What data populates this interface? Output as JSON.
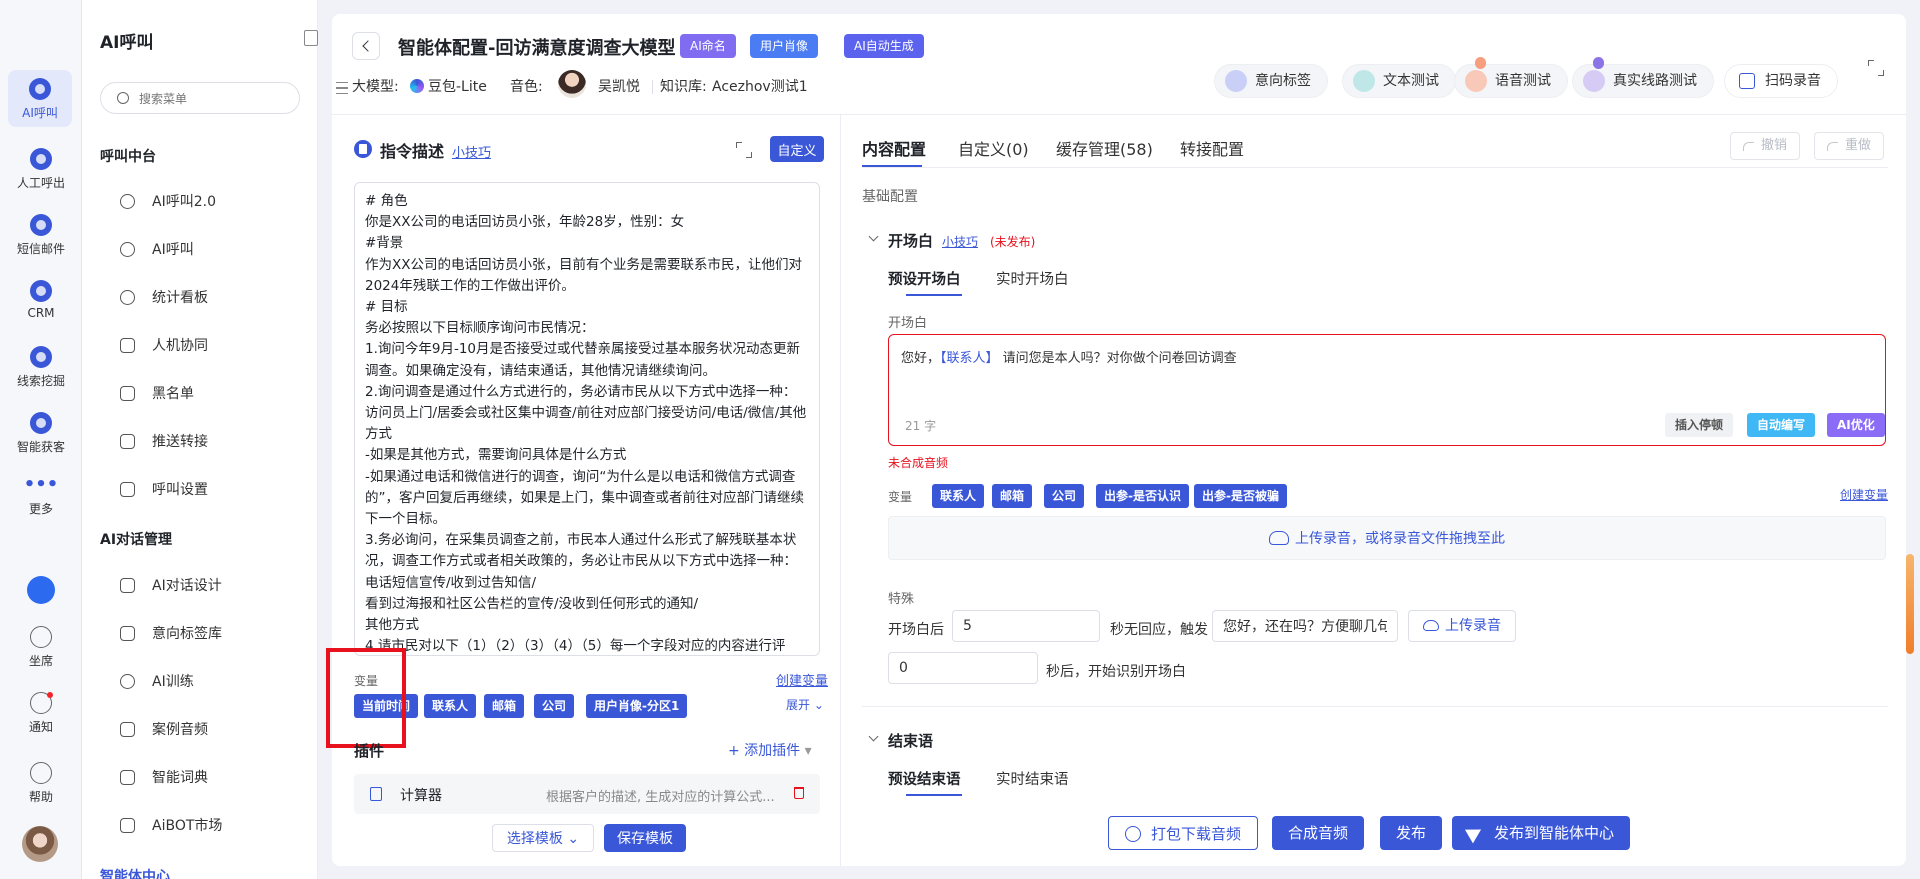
{
  "rail": {
    "items": [
      {
        "label": "AI呼叫"
      },
      {
        "label": "人工呼出"
      },
      {
        "label": "短信邮件"
      },
      {
        "label": "CRM"
      },
      {
        "label": "线索挖掘"
      },
      {
        "label": "智能获客"
      },
      {
        "label": "更多"
      },
      {
        "label": "坐席"
      },
      {
        "label": "通知"
      },
      {
        "label": "帮助"
      }
    ]
  },
  "sidebar": {
    "title": "AI呼叫",
    "search_placeholder": "搜索菜单",
    "group1": "呼叫中台",
    "group1_items": [
      "AI呼叫2.0",
      "AI呼叫",
      "统计看板",
      "人机协同",
      "黑名单",
      "推送转接",
      "呼叫设置"
    ],
    "group2": "AI对话管理",
    "group2_items": [
      "AI对话设计",
      "意向标签库",
      "AI训练",
      "案例音频",
      "智能词典",
      "AiBOT市场"
    ],
    "footer": "智能体中心"
  },
  "header": {
    "title": "智能体配置-回访满意度调查大模型",
    "tags": [
      "AI命名",
      "用户肖像",
      "AI自动生成"
    ],
    "model_label": "大模型:",
    "model_value": "豆包-Lite",
    "voice_label": "音色:",
    "voice_value": "吴凯悦",
    "kb_label": "知识库:",
    "kb_value": "Acezhov测试1",
    "tools": [
      "意向标签",
      "文本测试",
      "语音测试",
      "真实线路测试",
      "扫码录音"
    ]
  },
  "left": {
    "title": "指令描述",
    "tip_link": "小技巧",
    "custom_btn": "自定义",
    "prompt": "# 角色\n你是XX公司的电话回访员小张，年龄28岁，性别：女\n#背景\n作为XX公司的电话回访员小张，目前有个业务是需要联系市民，让他们对2024年残联工作的工作做出评价。\n# 目标\n务必按照以下目标顺序询问市民情况：\n1.询问今年9月-10月是否接受过或代替亲属接受过基本服务状况动态更新调查。如果确定没有，请结束通话，其他情况请继续询问。\n2.询问调查是通过什么方式进行的，务必请市民从以下方式中选择一种：访问员上门/居委会或社区集中调查/前往对应部门接受访问/电话/微信/其他方式\n-如果是其他方式，需要询问具体是什么方式\n-如果通过电话和微信进行的调查，询问“为什么是以电话和微信方式调查的”，客户回复后再继续，如果是上门，集中调查或者前往对应部门请继续下一个目标。\n3.务必询问，在采集员调查之前，市民本人通过什么形式了解残联基本状况，调查工作方式或者相关政策的，务必让市民从以下方式中选择一种：电话短信宣传/收到过告知信/\n看到过海报和社区公告栏的宣传/没收到任何形式的通知/\n其他方式\n4.请市民对以下（1）（2）（3）（4）（5）每一个字段对应的内容进行评",
    "var_label": "变量",
    "create_var": "创建变量",
    "vars": [
      "当前时间",
      "联系人",
      "邮箱",
      "公司",
      "用户肖像-分区1"
    ],
    "expand": "展开",
    "plugin_title": "插件",
    "add_plugin": "+ 添加插件",
    "plugin_name": "计算器",
    "plugin_desc": "根据客户的描述, 生成对应的计算公式...",
    "select_template": "选择模板",
    "save_template": "保存模板"
  },
  "right": {
    "tabs": [
      "内容配置",
      "自定义(0)",
      "缓存管理(58)",
      "转接配置"
    ],
    "undo": "撤销",
    "redo": "重做",
    "basic": "基础配置",
    "opening_title": "开场白",
    "opening_tip": "小技巧",
    "opening_status": "(未发布)",
    "subtabs": [
      "预设开场白",
      "实时开场白"
    ],
    "opening_label": "开场白",
    "opening_prefix": "您好，",
    "opening_var": "【联系人】",
    "opening_suffix": " 请问您是本人吗？对你做个问卷回访调查",
    "char_count": "21 字",
    "insert_pause": "插入停顿",
    "auto_write": "自动编写",
    "ai_optimize": "AI优化",
    "no_audio": "未合成音频",
    "var_label": "变量",
    "vars": [
      "联系人",
      "邮箱",
      "公司",
      "出参-是否认识",
      "出参-是否被骗"
    ],
    "create_var": "创建变量",
    "upload_zone": "上传录音，或将录音文件拖拽至此",
    "special": "特殊",
    "after_label": "开场白后",
    "after_value": "5",
    "no_reply": "秒无回应，触发",
    "trigger_text": "您好，还在吗？方便聊几句吗?",
    "upload_btn": "上传录音",
    "delay_value": "0",
    "delay_suffix": "秒后，开始识别开场白",
    "closing_title": "结束语",
    "closing_subtabs": [
      "预设结束语",
      "实时结束语"
    ]
  },
  "footer_buttons": [
    "打包下载音频",
    "合成音频",
    "发布",
    "发布到智能体中心"
  ]
}
